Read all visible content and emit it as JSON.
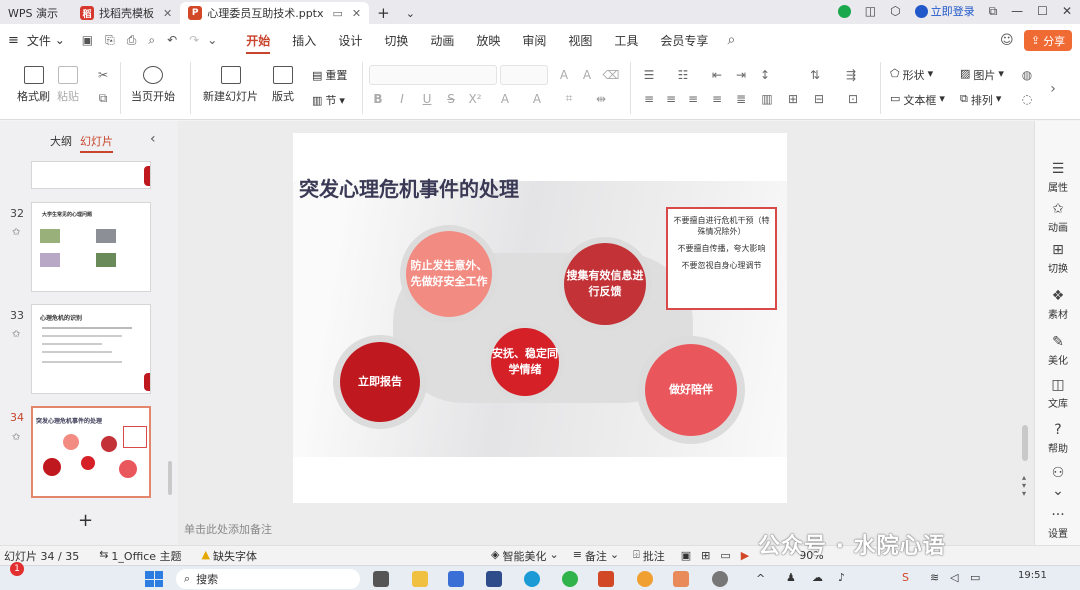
{
  "tabs": [
    {
      "label": "WPS 演示",
      "logo": ""
    },
    {
      "label": "找稻壳模板",
      "logo": "稻"
    },
    {
      "label": "心理委员互助技术.pptx",
      "logo": "P"
    }
  ],
  "login": "立即登录",
  "menu": {
    "file": "文件",
    "items": [
      "开始",
      "插入",
      "设计",
      "切换",
      "动画",
      "放映",
      "审阅",
      "视图",
      "工具",
      "会员专享"
    ],
    "active": "开始",
    "share": "分享"
  },
  "ribbon": {
    "format_painter": "格式刷",
    "paste": "粘贴",
    "start_from_current": "当页开始",
    "new_slide": "新建幻灯片",
    "layout": "版式",
    "reset": "重置",
    "section": "节",
    "shape": "形状",
    "picture": "图片",
    "textbox": "文本框",
    "arrange": "排列"
  },
  "left_panel": {
    "tab_outline": "大纲",
    "tab_slides": "幻灯片",
    "slides": [
      {
        "num": "32",
        "title": "大学生常见的心理问题"
      },
      {
        "num": "33",
        "title": "心理危机的识别"
      },
      {
        "num": "34",
        "title": "突发心理危机事件的处理"
      }
    ]
  },
  "slide": {
    "title": "突发心理危机事件的处理",
    "circles": [
      {
        "text": "防止发生意外、先做好安全工作"
      },
      {
        "text": "搜集有效信息进行反馈"
      },
      {
        "text": "立即报告"
      },
      {
        "text": "安抚、稳定同学情绪"
      },
      {
        "text": "做好陪伴"
      }
    ],
    "notes": [
      "不要擅自进行危机干预（特殊情况除外）",
      "不要擅自传播，夸大影响",
      "不要忽视自身心理调节"
    ]
  },
  "notes_placeholder": "单击此处添加备注",
  "right_sidebar": [
    "属性",
    "动画",
    "切换",
    "素材",
    "美化",
    "文库",
    "帮助",
    "设置"
  ],
  "status": {
    "slide_counter": "幻灯片 34 / 35",
    "theme": "1_Office 主题",
    "missing_font": "缺失字体",
    "smart_beautify": "智能美化",
    "notes": "备注",
    "comments": "批注",
    "zoom": "90%"
  },
  "taskbar": {
    "search": "搜索",
    "time": "19:51",
    "badge": "1"
  },
  "watermark": "公众号 · 水院心语",
  "colors": {
    "accent": "#c8442c",
    "share": "#f06a34",
    "circle_light": "#f28b82",
    "circle_dark": "#c0181f",
    "circle_mid": "#e04b52"
  }
}
